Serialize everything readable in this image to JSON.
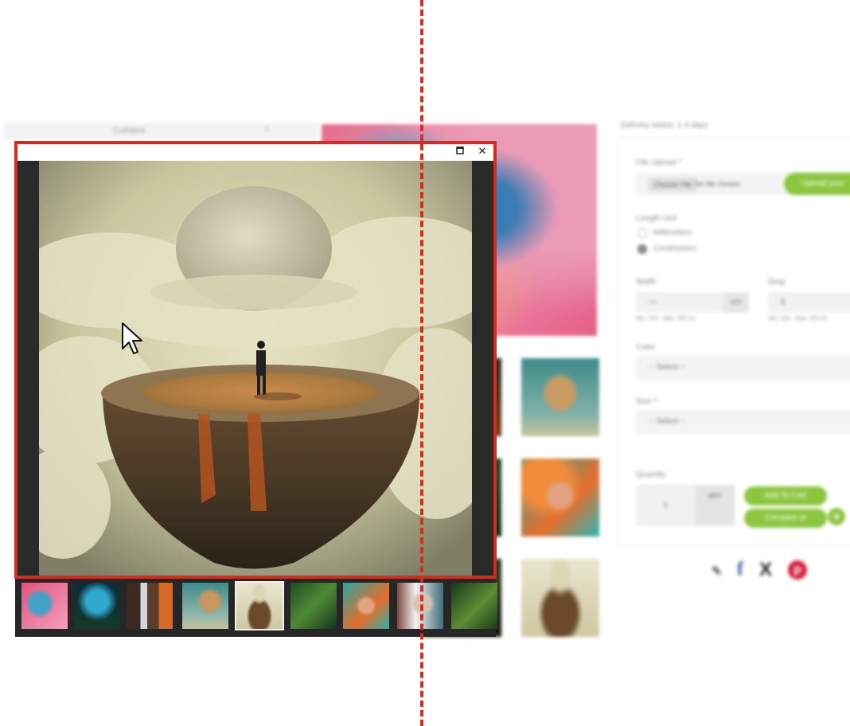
{
  "background_page": {
    "sidebar": {
      "label": "Curtains",
      "close_glyph": "×"
    },
    "form": {
      "delivery_text": "Delivery status: 1-3 days",
      "file_upload": {
        "label": "File Upload",
        "required_mark": "*",
        "choose_button": "Choose File",
        "no_file_text": "No file chosen",
        "upload_button": "Upload your"
      },
      "length_unit": {
        "label": "Length Unit",
        "options": [
          "Millimeters",
          "Centimeters"
        ],
        "selected": "Centimeters"
      },
      "width": {
        "label": "Width",
        "value": "—",
        "unit": "cm",
        "hint": "Min: 100 – Max: 200 cm"
      },
      "drop": {
        "label": "Drop",
        "value": "1",
        "hint": "Min: 100 – Max: 200 cm"
      },
      "color": {
        "label": "Color",
        "selected": "-- Select --"
      },
      "size": {
        "label": "Size",
        "required_mark": "*",
        "selected": "-- Select --"
      },
      "quantity": {
        "label": "Quantity",
        "value": "1",
        "unit": "pcs"
      },
      "add_to_cart_button": "Add To Cart",
      "compare_button": "Compare ⇄",
      "wishlist_icon": "heart-icon"
    },
    "share_icons": [
      "link-icon",
      "facebook-icon",
      "x-icon",
      "pinterest-icon"
    ]
  },
  "lightbox": {
    "maximize_icon": "maximize-icon",
    "close_icon": "close-icon",
    "current_image": "man-on-floating-island",
    "thumbnails": [
      "chameleon",
      "glowing-forest",
      "waterfall",
      "brain-tree",
      "floating-island",
      "green-stairs",
      "colorful-woman",
      "fragmented-face",
      "forest-path"
    ],
    "active_index": 4
  },
  "colors": {
    "accent_green": "#8cc63f",
    "annotation_red": "#d82a1f",
    "lightbox_dark": "#2a2a2a"
  }
}
